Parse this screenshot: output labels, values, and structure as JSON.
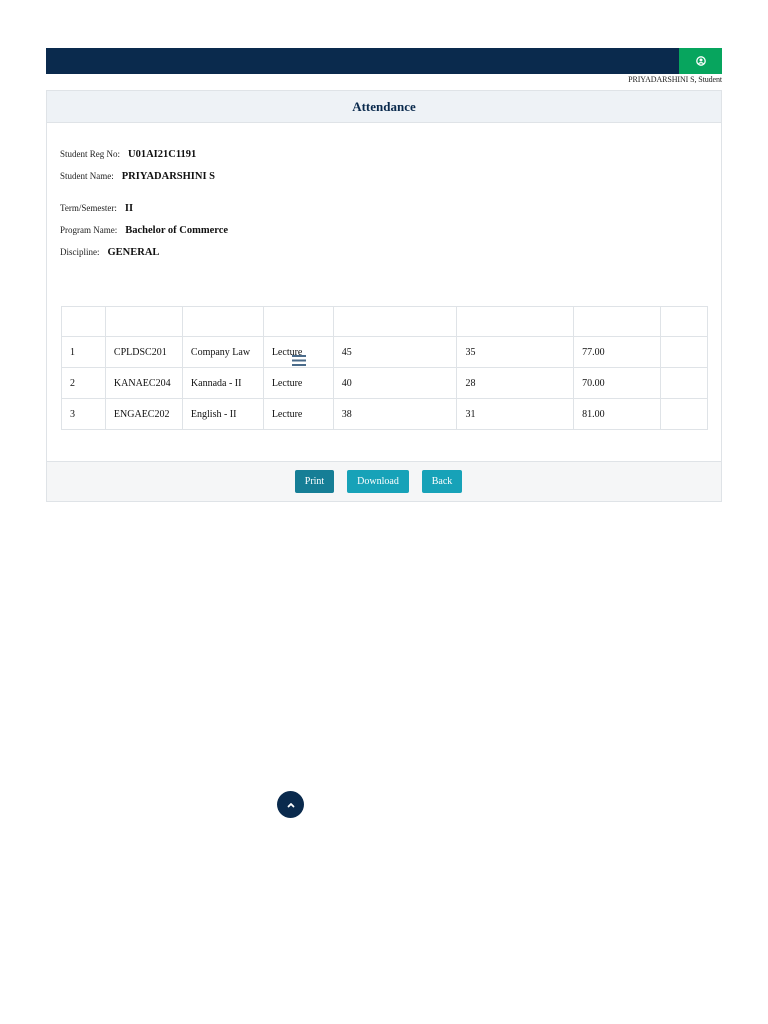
{
  "header": {
    "user_line": "PRIYADARSHINI S, Student",
    "user_icon": "user-circle-icon",
    "brand_color": "#0a2a4d",
    "accent_color": "#07a55e"
  },
  "card": {
    "title": "Attendance"
  },
  "student": {
    "reg_no_label": "Student Reg No:",
    "reg_no": "U01AI21C1191",
    "name_label": "Student Name:",
    "name": "PRIYADARSHINI S",
    "term_label": "Term/Semester:",
    "term": "II",
    "program_label": "Program Name:",
    "program": "Bachelor of Commerce",
    "discipline_label": "Discipline:",
    "discipline": "GENERAL"
  },
  "table": {
    "headers": [
      "",
      "",
      "",
      "",
      "",
      "",
      "",
      ""
    ],
    "rows": [
      [
        "1",
        "CPLDSC201",
        "Company Law",
        "Lecture",
        "45",
        "35",
        "77.00",
        ""
      ],
      [
        "2",
        "KANAEC204",
        "Kannada - II",
        "Lecture",
        "40",
        "28",
        "70.00",
        ""
      ],
      [
        "3",
        "ENGAEC202",
        "English - II",
        "Lecture",
        "38",
        "31",
        "81.00",
        ""
      ]
    ]
  },
  "actions": {
    "print": "Print",
    "download": "Download",
    "back": "Back"
  },
  "icons": {
    "menu": "menu-lines-icon",
    "scroll_top": "chevron-up-icon"
  }
}
